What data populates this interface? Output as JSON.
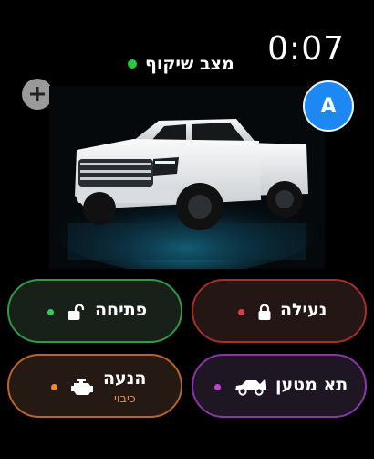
{
  "status": {
    "time": "0:07"
  },
  "mode": {
    "label": "מצב שיקוף",
    "indicator_color": "#27c93f"
  },
  "profile": {
    "initial": "A",
    "color": "#1e88f2"
  },
  "buttons": {
    "lock": {
      "label": "נעילה",
      "indicator_color": "#e23b3b",
      "border_color": "#a3302c",
      "icon": "lock-icon"
    },
    "unlock": {
      "label": "פתיחה",
      "indicator_color": "#2fcf5a",
      "border_color": "#2f9a48",
      "icon": "unlock-icon"
    },
    "trunk": {
      "label": "תא מטען",
      "indicator_color": "#c43fe0",
      "border_color": "#8a35a8",
      "icon": "car-trunk-icon"
    },
    "engine": {
      "label": "הנעה",
      "sub_label": "כיבוי",
      "indicator_color": "#f08a2c",
      "border_color": "#b8642c",
      "icon": "engine-icon"
    }
  }
}
